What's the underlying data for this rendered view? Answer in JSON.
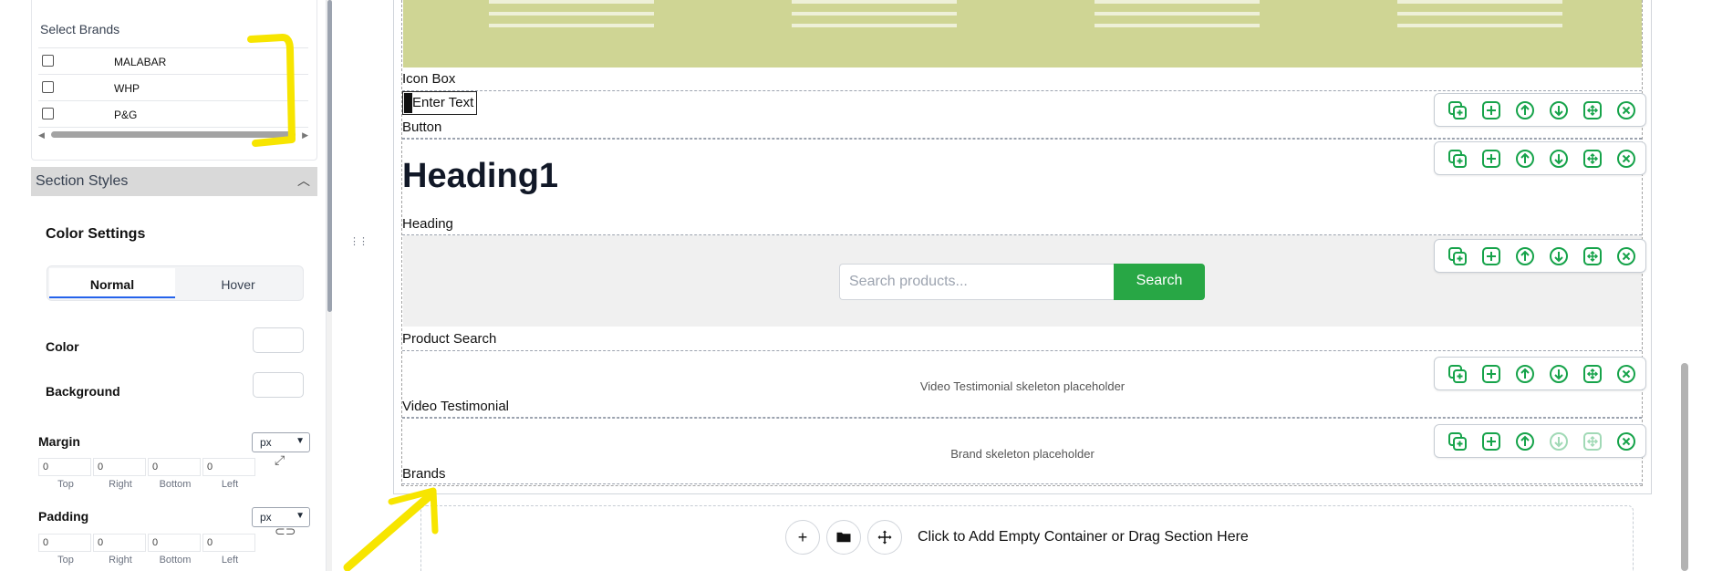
{
  "sidebar": {
    "brands_label": "Select Brands",
    "brands": [
      "MALABAR",
      "WHP",
      "P&G"
    ],
    "section_styles": "Section Styles",
    "color_settings": "Color Settings",
    "tabs": [
      "Normal",
      "Hover"
    ],
    "color_label": "Color",
    "background_label": "Background",
    "margin_label": "Margin",
    "padding_label": "Padding",
    "unit": "px",
    "margin_values": [
      "0",
      "0",
      "0",
      "0"
    ],
    "padding_values": [
      "0",
      "0",
      "0",
      "0"
    ],
    "sides": [
      "Top",
      "Right",
      "Bottom",
      "Left"
    ]
  },
  "canvas": {
    "icon_box_label": "Icon Box",
    "enter_text": "Enter Text",
    "button_label": "Button",
    "heading_text": "Heading1",
    "heading_label": "Heading",
    "search_placeholder": "Search products...",
    "search_button": "Search",
    "product_search_label": "Product Search",
    "video_placeholder": "Video Testimonial skeleton placeholder",
    "video_label": "Video Testimonial",
    "brand_placeholder": "Brand skeleton placeholder",
    "brands_label": "Brands",
    "drop_text": "Click to Add Empty Container or Drag Section Here"
  },
  "colors": {
    "hero": "#cfd594",
    "toolbar_icon": "#16a34a",
    "search_button": "#28a745",
    "annotation": "#f7e500"
  },
  "icons": {
    "toolbar": [
      "duplicate-icon",
      "add-icon",
      "move-up-icon",
      "move-down-icon",
      "drag-move-icon",
      "close-icon"
    ],
    "drop_zone": [
      "plus-icon",
      "folder-icon",
      "move-icon"
    ]
  }
}
